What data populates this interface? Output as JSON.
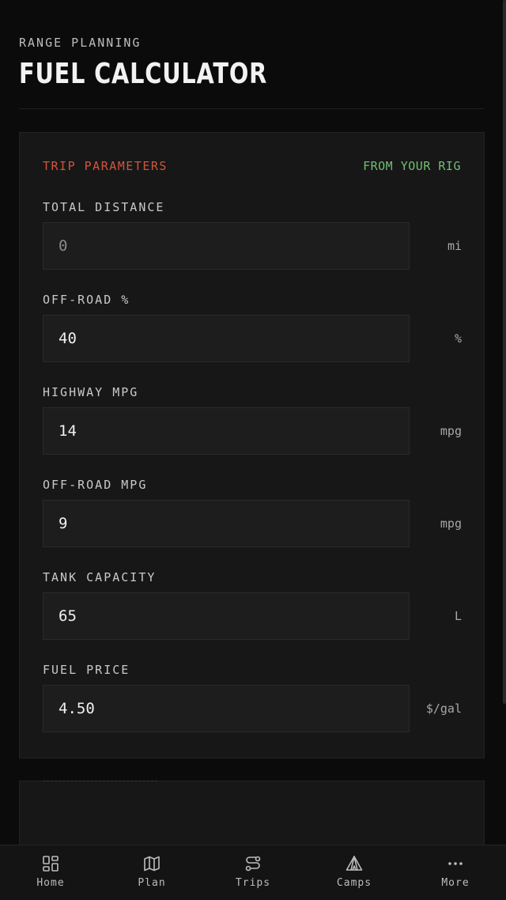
{
  "header": {
    "eyebrow": "RANGE PLANNING",
    "title": "FUEL CALCULATOR"
  },
  "trip": {
    "section_title": "TRIP PARAMETERS",
    "from_rig_label": "FROM YOUR RIG",
    "fields": [
      {
        "label": "TOTAL DISTANCE",
        "value": "",
        "placeholder": "0",
        "unit": "mi"
      },
      {
        "label": "OFF-ROAD %",
        "value": "40",
        "placeholder": "",
        "unit": "%"
      },
      {
        "label": "HIGHWAY MPG",
        "value": "14",
        "placeholder": "",
        "unit": "mpg"
      },
      {
        "label": "OFF-ROAD MPG",
        "value": "9",
        "placeholder": "",
        "unit": "mpg"
      },
      {
        "label": "TANK CAPACITY",
        "value": "65",
        "placeholder": "",
        "unit": "L"
      },
      {
        "label": "FUEL PRICE",
        "value": "4.50",
        "placeholder": "",
        "unit": "$/gal"
      }
    ]
  },
  "nav": {
    "items": [
      {
        "label": "Home",
        "icon": "grid-icon"
      },
      {
        "label": "Plan",
        "icon": "map-icon"
      },
      {
        "label": "Trips",
        "icon": "route-icon"
      },
      {
        "label": "Camps",
        "icon": "tent-icon"
      },
      {
        "label": "More",
        "icon": "more-dots-icon"
      }
    ]
  },
  "colors": {
    "background": "#0b0b0b",
    "card": "#171717",
    "accent_red": "#d2553b",
    "accent_green": "#6fbf73"
  }
}
